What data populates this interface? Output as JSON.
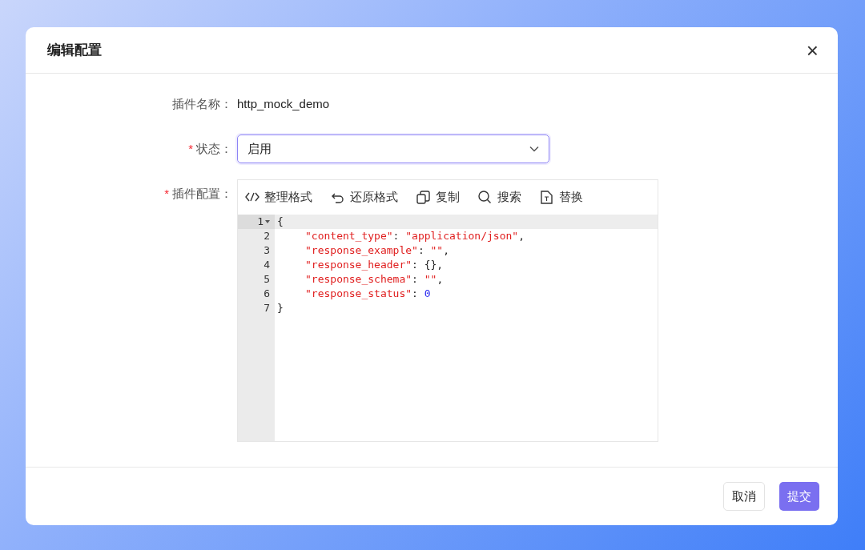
{
  "dialog": {
    "title": "编辑配置",
    "close": "×"
  },
  "form": {
    "plugin_name": {
      "label": "插件名称：",
      "value": "http_mock_demo"
    },
    "status": {
      "label": "状态：",
      "value": "启用",
      "required_mark": "*",
      "focused": true
    },
    "config": {
      "label": "插件配置：",
      "required_mark": "*",
      "toolbar": [
        {
          "kind": "format",
          "label": "整理格式"
        },
        {
          "kind": "undo",
          "label": "还原格式"
        },
        {
          "kind": "copy",
          "label": "复制"
        },
        {
          "kind": "search",
          "label": "搜索"
        },
        {
          "kind": "replace",
          "label": "替换"
        }
      ],
      "lines": [
        {
          "number": "1",
          "fold": true,
          "current": true,
          "indented": false,
          "tokens": [
            {
              "text": "{",
              "kind": "punct"
            }
          ]
        },
        {
          "number": "2",
          "fold": false,
          "current": false,
          "indented": true,
          "tokens": [
            {
              "text": "\"content_type\"",
              "kind": "string"
            },
            {
              "text": ": ",
              "kind": "punct"
            },
            {
              "text": "\"application/json\"",
              "kind": "string"
            },
            {
              "text": ",",
              "kind": "punct"
            }
          ]
        },
        {
          "number": "3",
          "fold": false,
          "current": false,
          "indented": true,
          "tokens": [
            {
              "text": "\"response_example\"",
              "kind": "string"
            },
            {
              "text": ": ",
              "kind": "punct"
            },
            {
              "text": "\"\"",
              "kind": "string"
            },
            {
              "text": ",",
              "kind": "punct"
            }
          ]
        },
        {
          "number": "4",
          "fold": false,
          "current": false,
          "indented": true,
          "tokens": [
            {
              "text": "\"response_header\"",
              "kind": "string"
            },
            {
              "text": ": {},",
              "kind": "punct"
            }
          ]
        },
        {
          "number": "5",
          "fold": false,
          "current": false,
          "indented": true,
          "tokens": [
            {
              "text": "\"response_schema\"",
              "kind": "string"
            },
            {
              "text": ": ",
              "kind": "punct"
            },
            {
              "text": "\"\"",
              "kind": "string"
            },
            {
              "text": ",",
              "kind": "punct"
            }
          ]
        },
        {
          "number": "6",
          "fold": false,
          "current": false,
          "indented": true,
          "tokens": [
            {
              "text": "\"response_status\"",
              "kind": "string"
            },
            {
              "text": ": ",
              "kind": "punct"
            },
            {
              "text": "0",
              "kind": "number"
            }
          ]
        },
        {
          "number": "7",
          "fold": false,
          "current": false,
          "indented": false,
          "tokens": [
            {
              "text": "}",
              "kind": "punct"
            }
          ]
        }
      ]
    }
  },
  "buttons": [
    {
      "kind": "secondary",
      "label": "取消"
    },
    {
      "kind": "primary",
      "label": "提交"
    }
  ]
}
